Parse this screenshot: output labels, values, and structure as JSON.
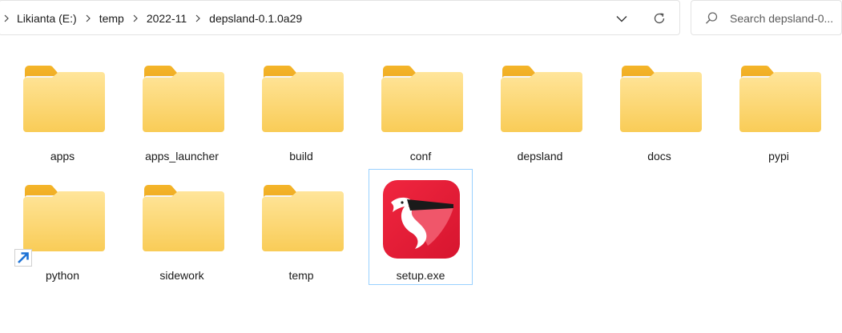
{
  "address_bar": {
    "breadcrumbs": [
      "Likianta (E:)",
      "temp",
      "2022-11",
      "depsland-0.1.0a29"
    ]
  },
  "search": {
    "placeholder": "Search depsland-0..."
  },
  "items": [
    {
      "label": "apps",
      "type": "folder"
    },
    {
      "label": "apps_launcher",
      "type": "folder"
    },
    {
      "label": "build",
      "type": "folder"
    },
    {
      "label": "conf",
      "type": "folder"
    },
    {
      "label": "depsland",
      "type": "folder"
    },
    {
      "label": "docs",
      "type": "folder"
    },
    {
      "label": "pypi",
      "type": "folder"
    },
    {
      "label": "python",
      "type": "folder-shortcut"
    },
    {
      "label": "sidework",
      "type": "folder"
    },
    {
      "label": "temp",
      "type": "folder"
    },
    {
      "label": "setup.exe",
      "type": "exe",
      "selected": true
    }
  ],
  "colors": {
    "folder_tab": "#f2b52e",
    "folder_front": "#fbd672",
    "exe_red": "#e8213e",
    "selection_border": "#99d1ff",
    "shortcut_arrow": "#1e73d6"
  }
}
